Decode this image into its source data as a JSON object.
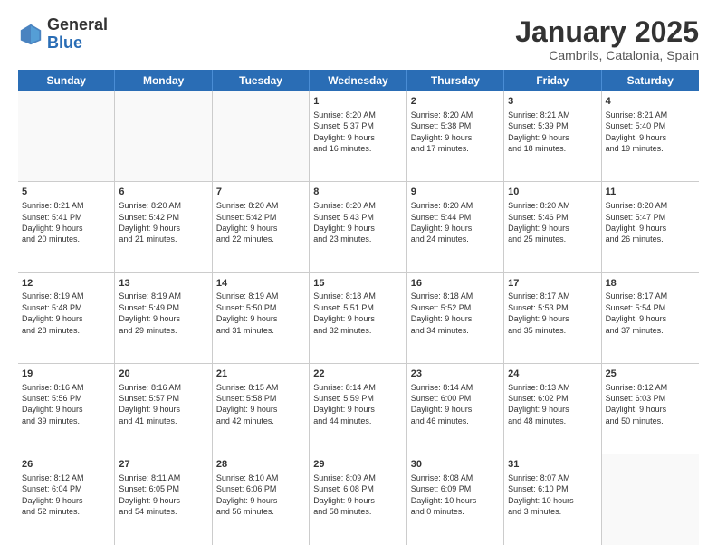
{
  "header": {
    "logo_general": "General",
    "logo_blue": "Blue",
    "month_year": "January 2025",
    "location": "Cambrils, Catalonia, Spain"
  },
  "weekdays": [
    "Sunday",
    "Monday",
    "Tuesday",
    "Wednesday",
    "Thursday",
    "Friday",
    "Saturday"
  ],
  "rows": [
    [
      {
        "day": "",
        "info": ""
      },
      {
        "day": "",
        "info": ""
      },
      {
        "day": "",
        "info": ""
      },
      {
        "day": "1",
        "info": "Sunrise: 8:20 AM\nSunset: 5:37 PM\nDaylight: 9 hours\nand 16 minutes."
      },
      {
        "day": "2",
        "info": "Sunrise: 8:20 AM\nSunset: 5:38 PM\nDaylight: 9 hours\nand 17 minutes."
      },
      {
        "day": "3",
        "info": "Sunrise: 8:21 AM\nSunset: 5:39 PM\nDaylight: 9 hours\nand 18 minutes."
      },
      {
        "day": "4",
        "info": "Sunrise: 8:21 AM\nSunset: 5:40 PM\nDaylight: 9 hours\nand 19 minutes."
      }
    ],
    [
      {
        "day": "5",
        "info": "Sunrise: 8:21 AM\nSunset: 5:41 PM\nDaylight: 9 hours\nand 20 minutes."
      },
      {
        "day": "6",
        "info": "Sunrise: 8:20 AM\nSunset: 5:42 PM\nDaylight: 9 hours\nand 21 minutes."
      },
      {
        "day": "7",
        "info": "Sunrise: 8:20 AM\nSunset: 5:42 PM\nDaylight: 9 hours\nand 22 minutes."
      },
      {
        "day": "8",
        "info": "Sunrise: 8:20 AM\nSunset: 5:43 PM\nDaylight: 9 hours\nand 23 minutes."
      },
      {
        "day": "9",
        "info": "Sunrise: 8:20 AM\nSunset: 5:44 PM\nDaylight: 9 hours\nand 24 minutes."
      },
      {
        "day": "10",
        "info": "Sunrise: 8:20 AM\nSunset: 5:46 PM\nDaylight: 9 hours\nand 25 minutes."
      },
      {
        "day": "11",
        "info": "Sunrise: 8:20 AM\nSunset: 5:47 PM\nDaylight: 9 hours\nand 26 minutes."
      }
    ],
    [
      {
        "day": "12",
        "info": "Sunrise: 8:19 AM\nSunset: 5:48 PM\nDaylight: 9 hours\nand 28 minutes."
      },
      {
        "day": "13",
        "info": "Sunrise: 8:19 AM\nSunset: 5:49 PM\nDaylight: 9 hours\nand 29 minutes."
      },
      {
        "day": "14",
        "info": "Sunrise: 8:19 AM\nSunset: 5:50 PM\nDaylight: 9 hours\nand 31 minutes."
      },
      {
        "day": "15",
        "info": "Sunrise: 8:18 AM\nSunset: 5:51 PM\nDaylight: 9 hours\nand 32 minutes."
      },
      {
        "day": "16",
        "info": "Sunrise: 8:18 AM\nSunset: 5:52 PM\nDaylight: 9 hours\nand 34 minutes."
      },
      {
        "day": "17",
        "info": "Sunrise: 8:17 AM\nSunset: 5:53 PM\nDaylight: 9 hours\nand 35 minutes."
      },
      {
        "day": "18",
        "info": "Sunrise: 8:17 AM\nSunset: 5:54 PM\nDaylight: 9 hours\nand 37 minutes."
      }
    ],
    [
      {
        "day": "19",
        "info": "Sunrise: 8:16 AM\nSunset: 5:56 PM\nDaylight: 9 hours\nand 39 minutes."
      },
      {
        "day": "20",
        "info": "Sunrise: 8:16 AM\nSunset: 5:57 PM\nDaylight: 9 hours\nand 41 minutes."
      },
      {
        "day": "21",
        "info": "Sunrise: 8:15 AM\nSunset: 5:58 PM\nDaylight: 9 hours\nand 42 minutes."
      },
      {
        "day": "22",
        "info": "Sunrise: 8:14 AM\nSunset: 5:59 PM\nDaylight: 9 hours\nand 44 minutes."
      },
      {
        "day": "23",
        "info": "Sunrise: 8:14 AM\nSunset: 6:00 PM\nDaylight: 9 hours\nand 46 minutes."
      },
      {
        "day": "24",
        "info": "Sunrise: 8:13 AM\nSunset: 6:02 PM\nDaylight: 9 hours\nand 48 minutes."
      },
      {
        "day": "25",
        "info": "Sunrise: 8:12 AM\nSunset: 6:03 PM\nDaylight: 9 hours\nand 50 minutes."
      }
    ],
    [
      {
        "day": "26",
        "info": "Sunrise: 8:12 AM\nSunset: 6:04 PM\nDaylight: 9 hours\nand 52 minutes."
      },
      {
        "day": "27",
        "info": "Sunrise: 8:11 AM\nSunset: 6:05 PM\nDaylight: 9 hours\nand 54 minutes."
      },
      {
        "day": "28",
        "info": "Sunrise: 8:10 AM\nSunset: 6:06 PM\nDaylight: 9 hours\nand 56 minutes."
      },
      {
        "day": "29",
        "info": "Sunrise: 8:09 AM\nSunset: 6:08 PM\nDaylight: 9 hours\nand 58 minutes."
      },
      {
        "day": "30",
        "info": "Sunrise: 8:08 AM\nSunset: 6:09 PM\nDaylight: 10 hours\nand 0 minutes."
      },
      {
        "day": "31",
        "info": "Sunrise: 8:07 AM\nSunset: 6:10 PM\nDaylight: 10 hours\nand 3 minutes."
      },
      {
        "day": "",
        "info": ""
      }
    ]
  ]
}
